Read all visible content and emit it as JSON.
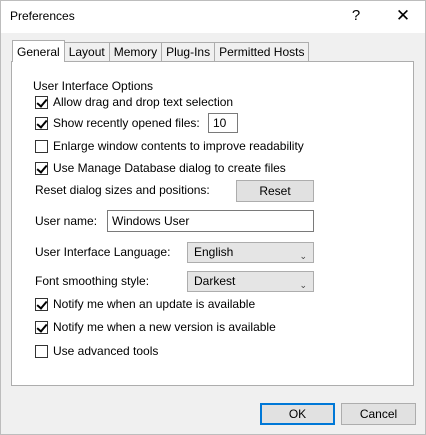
{
  "window": {
    "title": "Preferences",
    "help_label": "?",
    "close_label": "✕"
  },
  "tabs": [
    {
      "label": "General",
      "active": true
    },
    {
      "label": "Layout",
      "active": false
    },
    {
      "label": "Memory",
      "active": false
    },
    {
      "label": "Plug-Ins",
      "active": false
    },
    {
      "label": "Permitted Hosts",
      "active": false
    }
  ],
  "general": {
    "group_label": "User Interface Options",
    "allow_drag": {
      "label": "Allow drag and drop text selection",
      "checked": true
    },
    "recent_files": {
      "label": "Show recently opened files:",
      "checked": true,
      "value": "10"
    },
    "enlarge_window": {
      "label": "Enlarge window contents to improve readability",
      "checked": false
    },
    "manage_db": {
      "label": "Use Manage Database dialog to create files",
      "checked": true
    },
    "reset_label": "Reset dialog sizes and positions:",
    "reset_button": "Reset",
    "user_name_label": "User name:",
    "user_name_value": "Windows User",
    "ui_language_label": "User Interface Language:",
    "ui_language_value": "English",
    "font_smoothing_label": "Font smoothing style:",
    "font_smoothing_value": "Darkest",
    "notify_update": {
      "label": "Notify me when an update is available",
      "checked": true
    },
    "notify_version": {
      "label": "Notify me when a new version is available",
      "checked": true
    },
    "advanced_tools": {
      "label": "Use advanced tools",
      "checked": false
    }
  },
  "footer": {
    "ok_label": "OK",
    "cancel_label": "Cancel"
  },
  "icons": {
    "dropdown": "chevron-down-icon"
  }
}
